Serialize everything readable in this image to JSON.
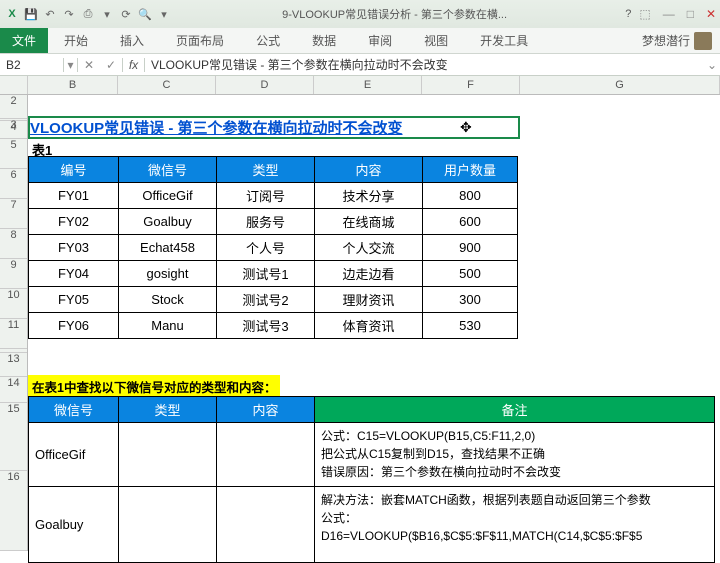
{
  "titlebar": {
    "app_title": "9-VLOOKUP常见错误分析 - 第三个参数在横...",
    "app_icon": "X"
  },
  "ribbon": {
    "file": "文件",
    "tabs": [
      "开始",
      "插入",
      "页面布局",
      "公式",
      "数据",
      "审阅",
      "视图",
      "开发工具"
    ],
    "username": "梦想潜行"
  },
  "formula_bar": {
    "name_box": "B2",
    "fx": "fx",
    "formula": "VLOOKUP常见错误 - 第三个参数在横向拉动时不会改变"
  },
  "columns": [
    "B",
    "C",
    "D",
    "E",
    "F",
    "G"
  ],
  "row_numbers": [
    "2",
    "3",
    "4",
    "5",
    "6",
    "7",
    "8",
    "9",
    "10",
    "11",
    "",
    "13",
    "14",
    "15",
    "16"
  ],
  "cells": {
    "title": "VLOOKUP常见错误 - 第三个参数在横向拉动时不会改变",
    "table1_label": "表1",
    "yellow_note": "在表1中查找以下微信号对应的类型和内容："
  },
  "table1": {
    "headers": [
      "编号",
      "微信号",
      "类型",
      "内容",
      "用户数量"
    ],
    "rows": [
      [
        "FY01",
        "OfficeGif",
        "订阅号",
        "技术分享",
        "800"
      ],
      [
        "FY02",
        "Goalbuy",
        "服务号",
        "在线商城",
        "600"
      ],
      [
        "FY03",
        "Echat458",
        "个人号",
        "个人交流",
        "900"
      ],
      [
        "FY04",
        "gosight",
        "测试号1",
        "边走边看",
        "500"
      ],
      [
        "FY05",
        "Stock",
        "测试号2",
        "理财资讯",
        "300"
      ],
      [
        "FY06",
        "Manu",
        "测试号3",
        "体育资讯",
        "530"
      ]
    ]
  },
  "table2": {
    "headers_blue": [
      "微信号",
      "类型",
      "内容"
    ],
    "header_green": "备注",
    "rows": [
      {
        "wechat": "OfficeGif",
        "type": "",
        "content": "",
        "remark": "公式：C15=VLOOKUP(B15,C5:F11,2,0)\n把公式从C15复制到D15，查找结果不正确\n错误原因：第三个参数在横向拉动时不会改变"
      },
      {
        "wechat": "Goalbuy",
        "type": "",
        "content": "",
        "remark": "解决方法：嵌套MATCH函数，根据列表题自动返回第三个参数\n公式：\nD16=VLOOKUP($B16,$C$5:$F$11,MATCH(C14,$C$5:$F$5"
      }
    ]
  }
}
